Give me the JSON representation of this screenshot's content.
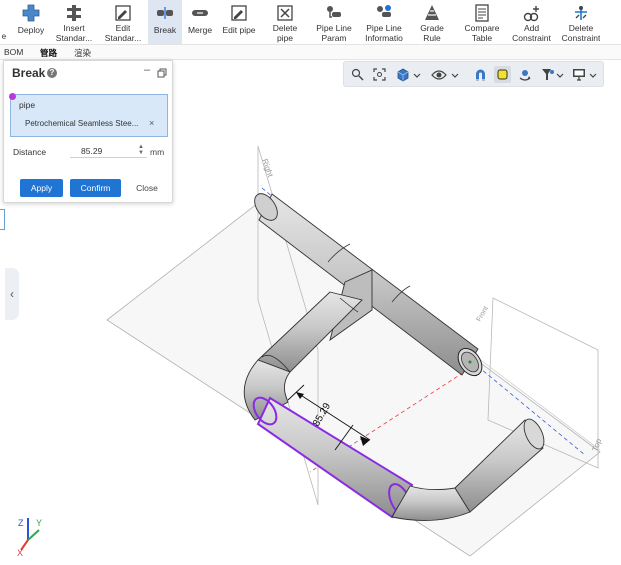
{
  "ribbon": {
    "tools": [
      {
        "label1": "Deploy",
        "label2": "",
        "icon": "deploy-icon"
      },
      {
        "label1": "Insert",
        "label2": "Standar...",
        "icon": "insert-standard-icon"
      },
      {
        "label1": "Edit",
        "label2": "Standar...",
        "icon": "edit-standard-icon"
      },
      {
        "label1": "Break",
        "label2": "",
        "icon": "break-icon",
        "active": true
      },
      {
        "label1": "Merge",
        "label2": "",
        "icon": "merge-icon"
      },
      {
        "label1": "Edit pipe",
        "label2": "",
        "icon": "edit-pipe-icon"
      },
      {
        "label1": "Delete",
        "label2": "pipe",
        "icon": "delete-pipe-icon"
      },
      {
        "label1": "Pipe Line",
        "label2": "Param",
        "icon": "pipe-line-param-icon"
      },
      {
        "label1": "Pipe Line",
        "label2": "Informatio",
        "icon": "pipe-line-info-icon"
      },
      {
        "label1": "Grade",
        "label2": "Rule",
        "icon": "grade-rule-icon"
      },
      {
        "label1": "Compare",
        "label2": "Table",
        "icon": "compare-table-icon"
      },
      {
        "label1": "Add",
        "label2": "Constraint",
        "icon": "add-constraint-icon"
      },
      {
        "label1": "Delete",
        "label2": "Constraint",
        "icon": "delete-constraint-icon"
      }
    ],
    "edge_char": "e"
  },
  "tabs": [
    "BOM",
    "管路",
    "渲染"
  ],
  "break_panel": {
    "title": "Break",
    "pipe_label": "pipe",
    "pipe_value": "Petrochemical Seamless Stee...",
    "remove_symbol": "×",
    "distance_label": "Distance",
    "distance_value": "85.29",
    "distance_unit": "mm",
    "apply": "Apply",
    "confirm": "Confirm",
    "close": "Close",
    "minimize_symbol": "–"
  },
  "view_toolbar": {
    "icons": [
      "zoom-icon",
      "zoom-fit-icon",
      "view-cube-icon",
      "visibility-icon",
      "magnet-icon",
      "shaded-mode-icon",
      "rotate-icon",
      "filter-icon",
      "display-icon"
    ]
  },
  "viewport": {
    "dimension_label": "85.29",
    "plane_labels": [
      "Right",
      "Front",
      "Top"
    ]
  },
  "triad": {
    "z": "Z",
    "y": "Y",
    "x": "X"
  },
  "colors": {
    "accent": "#1f74d4",
    "highlight": "#8a2be2",
    "pipe": "#c3c3c3",
    "panel_selection": "#d8e8f8"
  }
}
